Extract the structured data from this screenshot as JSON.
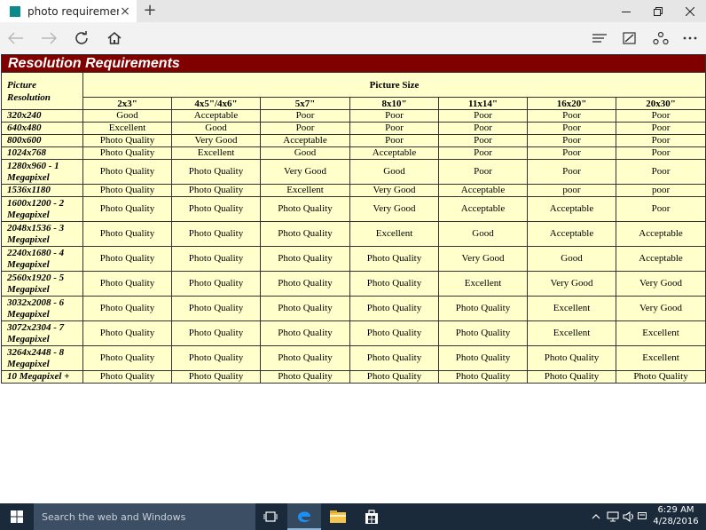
{
  "browser": {
    "tab_title": "photo requirement",
    "tab_close": "×",
    "new_tab": "+",
    "accent": "#0a8a8a"
  },
  "table": {
    "title": "Resolution Requirements",
    "corner_line1": "Picture",
    "corner_line2": "Resolution",
    "group_header": "Picture Size",
    "sizes": [
      "2x3\"",
      "4x5\"/4x6\"",
      "5x7\"",
      "8x10\"",
      "11x14\"",
      "16x20\"",
      "20x30\""
    ],
    "rows": [
      {
        "res": "320x240",
        "tall": false,
        "values": [
          "Good",
          "Acceptable",
          "Poor",
          "Poor",
          "Poor",
          "Poor",
          "Poor"
        ]
      },
      {
        "res": "640x480",
        "tall": false,
        "values": [
          "Excellent",
          "Good",
          "Poor",
          "Poor",
          "Poor",
          "Poor",
          "Poor"
        ]
      },
      {
        "res": "800x600",
        "tall": false,
        "values": [
          "Photo Quality",
          "Very Good",
          "Acceptable",
          "Poor",
          "Poor",
          "Poor",
          "Poor"
        ]
      },
      {
        "res": "1024x768",
        "tall": false,
        "values": [
          "Photo Quality",
          "Excellent",
          "Good",
          "Acceptable",
          "Poor",
          "Poor",
          "Poor"
        ]
      },
      {
        "res": "1280x960 - 1 Megapixel",
        "tall": true,
        "values": [
          "Photo Quality",
          "Photo Quality",
          "Very Good",
          "Good",
          "Poor",
          "Poor",
          "Poor"
        ]
      },
      {
        "res": "1536x1180",
        "tall": false,
        "values": [
          "Photo Quality",
          "Photo Quality",
          "Excellent",
          "Very Good",
          "Acceptable",
          "poor",
          "poor"
        ]
      },
      {
        "res": "1600x1200 - 2 Megapixel",
        "tall": true,
        "values": [
          "Photo Quality",
          "Photo Quality",
          "Photo Quality",
          "Very Good",
          "Acceptable",
          "Acceptable",
          "Poor"
        ]
      },
      {
        "res": "2048x1536 - 3 Megapixel",
        "tall": true,
        "values": [
          "Photo Quality",
          "Photo Quality",
          "Photo Quality",
          "Excellent",
          "Good",
          "Acceptable",
          "Acceptable"
        ]
      },
      {
        "res": "2240x1680 - 4 Megapixel",
        "tall": true,
        "values": [
          "Photo Quality",
          "Photo Quality",
          "Photo Quality",
          "Photo Quality",
          "Very Good",
          "Good",
          "Acceptable"
        ]
      },
      {
        "res": "2560x1920 - 5 Megapixel",
        "tall": true,
        "values": [
          "Photo Quality",
          "Photo Quality",
          "Photo Quality",
          "Photo Quality",
          "Excellent",
          "Very Good",
          "Very Good"
        ]
      },
      {
        "res": "3032x2008 - 6 Megapixel",
        "tall": true,
        "values": [
          "Photo Quality",
          "Photo Quality",
          "Photo Quality",
          "Photo Quality",
          "Photo Quality",
          "Excellent",
          "Very Good"
        ]
      },
      {
        "res": "3072x2304 - 7 Megapixel",
        "tall": true,
        "values": [
          "Photo Quality",
          "Photo Quality",
          "Photo Quality",
          "Photo Quality",
          "Photo Quality",
          "Excellent",
          "Excellent"
        ]
      },
      {
        "res": "3264x2448 - 8 Megapixel",
        "tall": true,
        "values": [
          "Photo Quality",
          "Photo Quality",
          "Photo Quality",
          "Photo Quality",
          "Photo Quality",
          "Photo Quality",
          "Excellent"
        ]
      },
      {
        "res": "10 Megapixel +",
        "tall": false,
        "values": [
          "Photo Quality",
          "Photo Quality",
          "Photo Quality",
          "Photo Quality",
          "Photo Quality",
          "Photo Quality",
          "Photo Quality"
        ]
      }
    ],
    "header_bg": "#800000",
    "cell_bg": "#ffffcc"
  },
  "taskbar": {
    "search_placeholder": "Search the web and Windows",
    "time": "6:29 AM",
    "date": "4/28/2016",
    "bg": "#1b2a3a"
  }
}
